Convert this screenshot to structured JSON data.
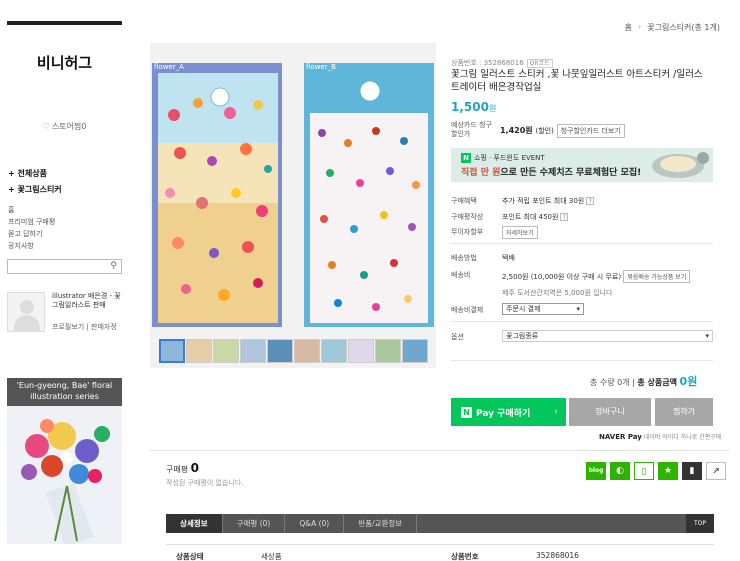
{
  "breadcrumb": {
    "home": "홈",
    "current": "꽃그림스티커(총 1개)"
  },
  "sidebar": {
    "store_name": "비니허그",
    "favorite": "스토어찜0",
    "categories": [
      "전체상품",
      "꽃그림스티커"
    ],
    "links": [
      "홈",
      "프리미엄 구매평",
      "묻고 답하기",
      "공지사항"
    ],
    "profile_name": "illustrator 배은경 - 꽃그림일러스트 판매",
    "profile_links": [
      "프로필보기",
      "판매자정"
    ],
    "banner_caption": "'Eun-gyeong, Bae' floral illustration series"
  },
  "gallery": {
    "left_label": "flower_A",
    "right_label": "flower_B",
    "thumb_count": 10
  },
  "product": {
    "number_label": "상품번호 : 352868016",
    "qr_label": "QR코드",
    "title": "꽃그림 일러스트 스티커 ,꽃 나뭇잎일러스트 아트스티커 /일러스트레이터 배은경작업실",
    "price": "1,500",
    "price_unit": "원",
    "card_label": "예상카드 청구할인가",
    "card_price": "1,420원",
    "card_note": "(할인)",
    "card_btn": "청구할인카드 더보기",
    "promo_tag": "쇼핑 · 푸드윈도 EVENT",
    "promo_text_a": "직접 만 원",
    "promo_text_b": "으로 만든 수제치즈 무료체험단 모집!",
    "benefit_label": "구매혜택",
    "benefit_value": "추가 적립 포인트 최대 30원",
    "review_label": "구매평작성",
    "review_value": "포인트 최대 450원",
    "interest_label": "무이자할부",
    "interest_btn": "자세히보기",
    "ship_method_label": "배송방법",
    "ship_method_value": "택배",
    "ship_fee_label": "배송비",
    "ship_fee_value": "2,500원 (10,000원 이상 구매 시 무료)",
    "ship_fee_btn": "묶음배송 가능상품 보기",
    "ship_island": "제주 도서산간지역은 5,000원 입니다",
    "ship_pay_label": "배송비결제",
    "ship_pay_value": "주문시 결제",
    "option_label": "옵션",
    "option_value": "꽃그림종류",
    "total_qty": "총 수량 0개",
    "total_label": "총 상품금액",
    "total_value": "0원",
    "btn_pay": "Pay 구매하기",
    "btn_cart": "장바구니",
    "btn_wish": "찜하기",
    "npay_brand": "NAVER Pay",
    "npay_note": "네이버 아이디 하나로 간편구매"
  },
  "purchase": {
    "label": "구매평",
    "count": "0",
    "empty": "작성된 구매평이 없습니다."
  },
  "social": [
    "blog-icon",
    "band-icon",
    "phone-icon",
    "star-icon",
    "bookmark-icon",
    "share-icon"
  ],
  "tabs": [
    "상세정보",
    "구매평 (0)",
    "Q&A (0)",
    "반품/교환정보"
  ],
  "tab_top": "TOP",
  "spec": {
    "status_label": "상품상태",
    "status_value": "새상품",
    "no_label": "상품번호",
    "no_value": "352868016"
  },
  "colors": {
    "accent": "#1ba7c4",
    "naver": "#03c75a",
    "tab_bg": "#555555"
  }
}
